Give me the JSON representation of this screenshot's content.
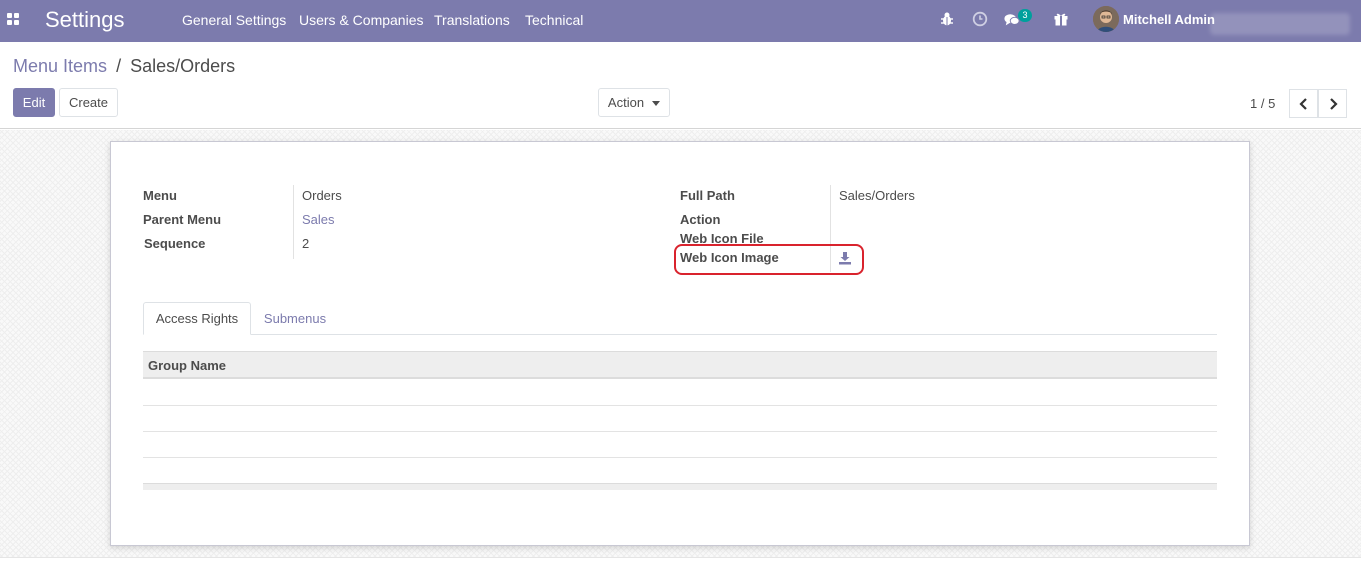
{
  "navbar": {
    "app_title": "Settings",
    "menu": [
      "General Settings",
      "Users & Companies",
      "Translations",
      "Technical"
    ],
    "icons": [
      "bug-icon",
      "clock-icon",
      "chat-icon",
      "gift-icon"
    ],
    "messages_count": "3",
    "user_name": "Mitchell Admin",
    "bg_color": "#7c7bad"
  },
  "breadcrumb": {
    "parent": "Menu Items",
    "separator": "/",
    "current": "Sales/Orders"
  },
  "toolbar": {
    "edit_label": "Edit",
    "create_label": "Create",
    "action_label": "Action"
  },
  "pager": {
    "value": "1 / 5"
  },
  "form": {
    "left": [
      {
        "label": "Menu",
        "value": "Orders"
      },
      {
        "label": "Parent Menu",
        "value": "Sales"
      },
      {
        "label": "Sequence",
        "value": "2"
      }
    ],
    "right": [
      {
        "label": "Full Path",
        "value": "Sales/Orders"
      },
      {
        "label": "Action",
        "value": ""
      },
      {
        "label": "Web Icon File",
        "value": ""
      },
      {
        "label": "Web Icon Image",
        "value": ""
      }
    ]
  },
  "tabs": [
    {
      "label": "Access Rights",
      "active": true
    },
    {
      "label": "Submenus",
      "active": false
    }
  ],
  "table": {
    "columns": [
      "Group Name"
    ],
    "rows": []
  },
  "colors": {
    "accent": "#7c7bad",
    "highlight": "#d9232d",
    "badge": "#00a09d"
  }
}
